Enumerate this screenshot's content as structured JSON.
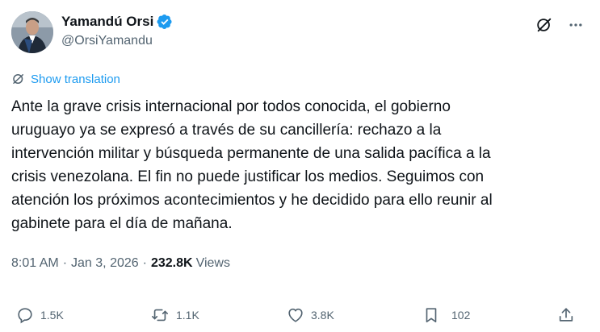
{
  "author": {
    "display_name": "Yamandú Orsi",
    "handle": "@OrsiYamandu",
    "verified": true,
    "accent_color": "#1d9bf0"
  },
  "header_actions": {
    "icons": [
      "grok-icon",
      "more-icon"
    ]
  },
  "translate": {
    "label": "Show translation"
  },
  "tweet": {
    "text": "Ante la grave crisis internacional por todos conocida, el gobierno\nuruguayo ya se expresó a través de su cancillería: rechazo a la\nintervención militar y búsqueda permanente de una salida pacífica a la\ncrisis venezolana. El fin no puede justificar los medios. Seguimos con\natención los próximos acontecimientos y he decidido para ello reunir al\ngabinete para el día de mañana."
  },
  "meta": {
    "time": "8:01 AM",
    "separator": "·",
    "date": "Jan 3, 2026",
    "views_count": "232.8K",
    "views_label": "Views"
  },
  "actions": {
    "reply_count": "1.5K",
    "retweet_count": "1.1K",
    "like_count": "3.8K",
    "bookmark_count": "102"
  },
  "colors": {
    "text_primary": "#0f1419",
    "text_secondary": "#536471",
    "link": "#1d9bf0"
  }
}
